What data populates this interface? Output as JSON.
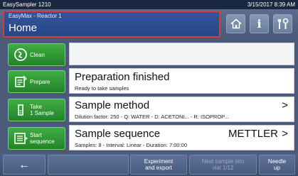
{
  "titlebar": {
    "app_name": "EasySampler 1210",
    "datetime": "3/15/2017 8:39 AM"
  },
  "header": {
    "location_sub": "EasyMax - Reactor 1",
    "location_title": "Home",
    "icons": [
      "home-icon",
      "info-icon",
      "tools-icon"
    ],
    "info_glyph": "i"
  },
  "actions": {
    "clean_label": "Clean",
    "prepare_label": "Prepare",
    "take_label_line1": "Take",
    "take_label_line2": "1 Sample",
    "start_label_line1": "Start",
    "start_label_line2": "sequence"
  },
  "panels": {
    "preparation": {
      "title": "Preparation finished",
      "subtitle": "Ready to take samples"
    },
    "method": {
      "title": "Sample method",
      "subtitle": "Dilution factor: 250 - Q: WATER - D: ACETONI... - R: ISOPROP...",
      "chevron": ">"
    },
    "sequence": {
      "title": "Sample sequence",
      "vendor": "METTLER",
      "subtitle": "Samples: 8 - Interval: Linear - Duration: 7:00:00",
      "chevron": ">"
    }
  },
  "bottom": {
    "back_glyph": "←",
    "experiment_line1": "Experiment",
    "experiment_line2": "and export",
    "next_line1": "Next sample into",
    "next_line2": "vial 1/12",
    "needle_line1": "Needle",
    "needle_line2": "up"
  },
  "colors": {
    "accent_green": "#2f9a34",
    "header_blue": "#2c4d92",
    "highlight_red": "#d33d3d"
  }
}
